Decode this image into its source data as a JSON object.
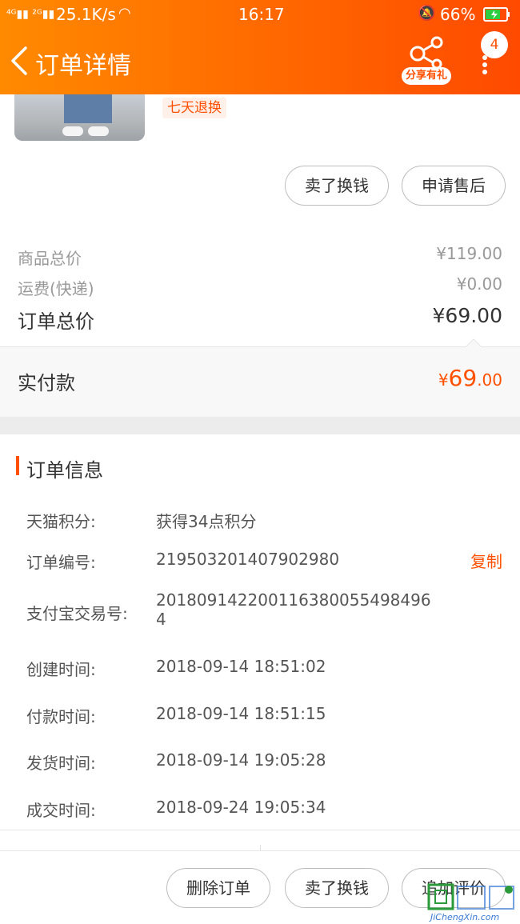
{
  "status_bar": {
    "net_speed": "25.1K/s",
    "time": "16:17",
    "battery": "66%"
  },
  "header": {
    "title": "订单详情",
    "share_label": "分享有礼",
    "message_count": "4"
  },
  "product": {
    "return_tag": "七天退换"
  },
  "item_actions": {
    "sell": "卖了换钱",
    "after_sale": "申请售后"
  },
  "price_summary": {
    "goods_total_label": "商品总价",
    "goods_total_value": "¥119.00",
    "shipping_label": "运费(快递)",
    "shipping_value": "¥0.00",
    "order_total_label": "订单总价",
    "order_total_value": "¥69.00",
    "paid_label": "实付款",
    "paid_currency": "¥",
    "paid_integer": "69",
    "paid_decimal": ".00"
  },
  "order_info": {
    "title": "订单信息",
    "points_label": "天猫积分:",
    "points_value": "获得34点积分",
    "order_no_label": "订单编号:",
    "order_no_value": "219503201407902980",
    "copy_label": "复制",
    "alipay_label": "支付宝交易号:",
    "alipay_value": "2018091422001163800554984964",
    "created_label": "创建时间:",
    "created_value": "2018-09-14 18:51:02",
    "paid_time_label": "付款时间:",
    "paid_time_value": "2018-09-14 18:51:15",
    "shipped_label": "发货时间:",
    "shipped_value": "2018-09-14 19:05:28",
    "completed_label": "成交时间:",
    "completed_value": "2018-09-24 19:05:34"
  },
  "bottom_actions": {
    "delete": "删除订单",
    "sell": "卖了换钱",
    "review": "追加评价"
  },
  "watermark": {
    "text": "JiChengXin.com"
  },
  "colors": {
    "accent": "#ff5000",
    "header_start": "#ff8a00",
    "header_end": "#ff4a00"
  }
}
